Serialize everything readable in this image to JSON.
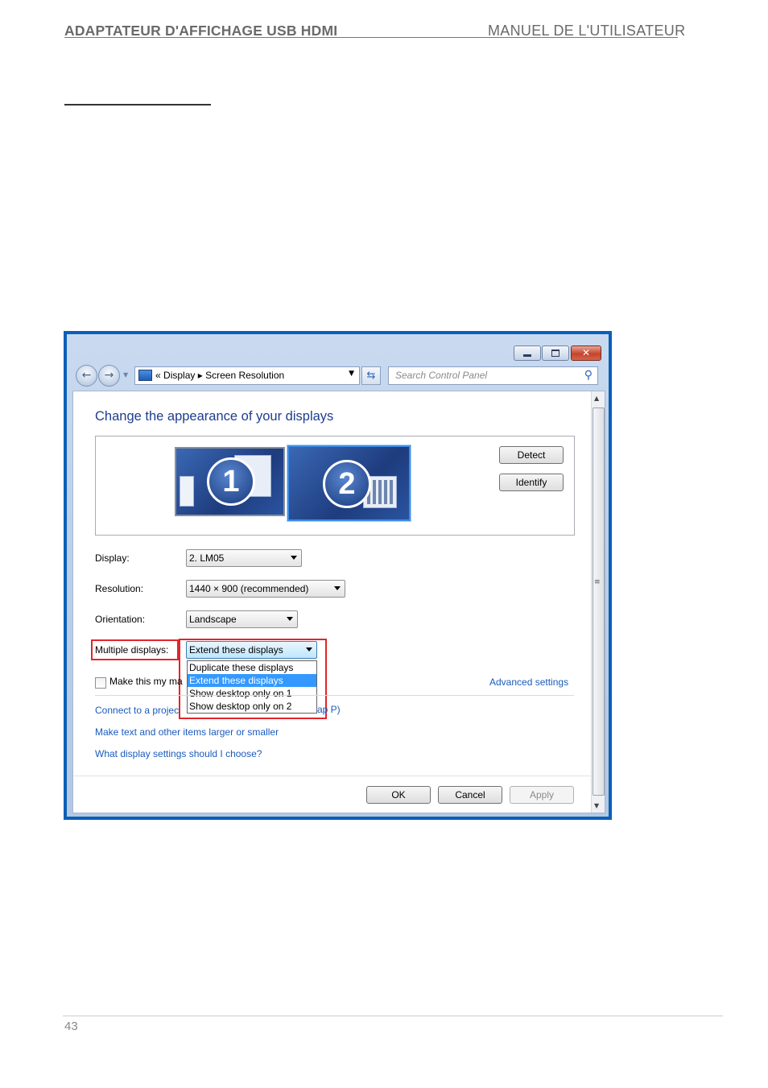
{
  "doc": {
    "header_left": "ADAPTATEUR D'AFFICHAGE USB HDMI",
    "header_right": "MANUEL DE L'UTILISATEUR",
    "page_number": "43"
  },
  "window": {
    "nav": {
      "back_glyph": "←",
      "forward_glyph": "→",
      "breadcrumb_prefix": "«",
      "crumb_1": "Display",
      "crumb_sep": "▸",
      "crumb_2": "Screen Resolution",
      "search_placeholder": "Search Control Panel"
    },
    "close_glyph": "✕",
    "content": {
      "title": "Change the appearance of your displays",
      "monitor_1": "1",
      "monitor_2": "2",
      "detect_label": "Detect",
      "identify_label": "Identify",
      "display_label": "Display:",
      "display_value": "2. LM05",
      "resolution_label": "Resolution:",
      "resolution_value": "1440 × 900 (recommended)",
      "orientation_label": "Orientation:",
      "orientation_value": "Landscape",
      "multiple_label": "Multiple displays:",
      "multiple_value": "Extend these displays",
      "dropdown_options": [
        "Duplicate these displays",
        "Extend these displays",
        "Show desktop only on 1",
        "Show desktop only on 2"
      ],
      "selected_option": "Extend these displays",
      "main_display_label": "Make this my ma",
      "advanced_link": "Advanced settings",
      "projector_link": "Connect to a projec",
      "projector_tail": "ap P)",
      "text_size_link": "Make text and other items larger or smaller",
      "help_link": "What display settings should I choose?",
      "ok_label": "OK",
      "cancel_label": "Cancel",
      "apply_label": "Apply"
    }
  },
  "colors": {
    "window_border": "#0b5fb7",
    "title_text": "#1e3d8f",
    "link_text": "#1a5bbd",
    "highlight_box": "#e3242b",
    "selection": "#3399ff"
  }
}
